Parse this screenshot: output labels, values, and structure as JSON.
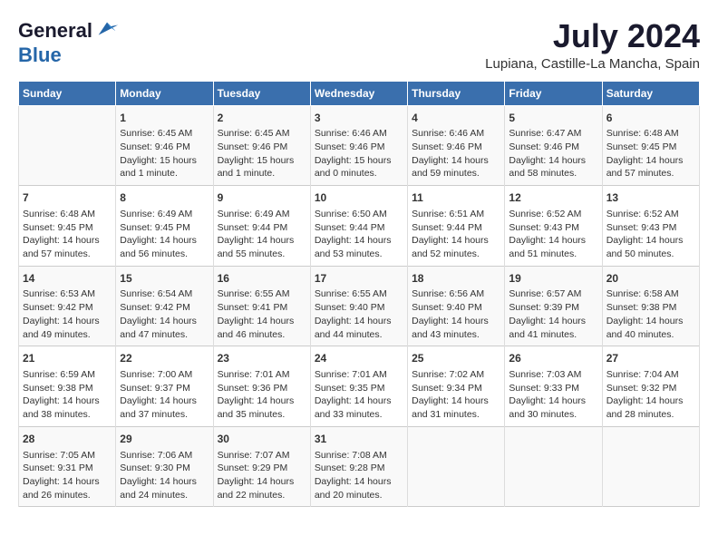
{
  "header": {
    "logo_general": "General",
    "logo_blue": "Blue",
    "month": "July 2024",
    "location": "Lupiana, Castille-La Mancha, Spain"
  },
  "days_of_week": [
    "Sunday",
    "Monday",
    "Tuesday",
    "Wednesday",
    "Thursday",
    "Friday",
    "Saturday"
  ],
  "weeks": [
    [
      {
        "day": "",
        "content": ""
      },
      {
        "day": "1",
        "content": "Sunrise: 6:45 AM\nSunset: 9:46 PM\nDaylight: 15 hours\nand 1 minute."
      },
      {
        "day": "2",
        "content": "Sunrise: 6:45 AM\nSunset: 9:46 PM\nDaylight: 15 hours\nand 1 minute."
      },
      {
        "day": "3",
        "content": "Sunrise: 6:46 AM\nSunset: 9:46 PM\nDaylight: 15 hours\nand 0 minutes."
      },
      {
        "day": "4",
        "content": "Sunrise: 6:46 AM\nSunset: 9:46 PM\nDaylight: 14 hours\nand 59 minutes."
      },
      {
        "day": "5",
        "content": "Sunrise: 6:47 AM\nSunset: 9:46 PM\nDaylight: 14 hours\nand 58 minutes."
      },
      {
        "day": "6",
        "content": "Sunrise: 6:48 AM\nSunset: 9:45 PM\nDaylight: 14 hours\nand 57 minutes."
      }
    ],
    [
      {
        "day": "7",
        "content": "Sunrise: 6:48 AM\nSunset: 9:45 PM\nDaylight: 14 hours\nand 57 minutes."
      },
      {
        "day": "8",
        "content": "Sunrise: 6:49 AM\nSunset: 9:45 PM\nDaylight: 14 hours\nand 56 minutes."
      },
      {
        "day": "9",
        "content": "Sunrise: 6:49 AM\nSunset: 9:44 PM\nDaylight: 14 hours\nand 55 minutes."
      },
      {
        "day": "10",
        "content": "Sunrise: 6:50 AM\nSunset: 9:44 PM\nDaylight: 14 hours\nand 53 minutes."
      },
      {
        "day": "11",
        "content": "Sunrise: 6:51 AM\nSunset: 9:44 PM\nDaylight: 14 hours\nand 52 minutes."
      },
      {
        "day": "12",
        "content": "Sunrise: 6:52 AM\nSunset: 9:43 PM\nDaylight: 14 hours\nand 51 minutes."
      },
      {
        "day": "13",
        "content": "Sunrise: 6:52 AM\nSunset: 9:43 PM\nDaylight: 14 hours\nand 50 minutes."
      }
    ],
    [
      {
        "day": "14",
        "content": "Sunrise: 6:53 AM\nSunset: 9:42 PM\nDaylight: 14 hours\nand 49 minutes."
      },
      {
        "day": "15",
        "content": "Sunrise: 6:54 AM\nSunset: 9:42 PM\nDaylight: 14 hours\nand 47 minutes."
      },
      {
        "day": "16",
        "content": "Sunrise: 6:55 AM\nSunset: 9:41 PM\nDaylight: 14 hours\nand 46 minutes."
      },
      {
        "day": "17",
        "content": "Sunrise: 6:55 AM\nSunset: 9:40 PM\nDaylight: 14 hours\nand 44 minutes."
      },
      {
        "day": "18",
        "content": "Sunrise: 6:56 AM\nSunset: 9:40 PM\nDaylight: 14 hours\nand 43 minutes."
      },
      {
        "day": "19",
        "content": "Sunrise: 6:57 AM\nSunset: 9:39 PM\nDaylight: 14 hours\nand 41 minutes."
      },
      {
        "day": "20",
        "content": "Sunrise: 6:58 AM\nSunset: 9:38 PM\nDaylight: 14 hours\nand 40 minutes."
      }
    ],
    [
      {
        "day": "21",
        "content": "Sunrise: 6:59 AM\nSunset: 9:38 PM\nDaylight: 14 hours\nand 38 minutes."
      },
      {
        "day": "22",
        "content": "Sunrise: 7:00 AM\nSunset: 9:37 PM\nDaylight: 14 hours\nand 37 minutes."
      },
      {
        "day": "23",
        "content": "Sunrise: 7:01 AM\nSunset: 9:36 PM\nDaylight: 14 hours\nand 35 minutes."
      },
      {
        "day": "24",
        "content": "Sunrise: 7:01 AM\nSunset: 9:35 PM\nDaylight: 14 hours\nand 33 minutes."
      },
      {
        "day": "25",
        "content": "Sunrise: 7:02 AM\nSunset: 9:34 PM\nDaylight: 14 hours\nand 31 minutes."
      },
      {
        "day": "26",
        "content": "Sunrise: 7:03 AM\nSunset: 9:33 PM\nDaylight: 14 hours\nand 30 minutes."
      },
      {
        "day": "27",
        "content": "Sunrise: 7:04 AM\nSunset: 9:32 PM\nDaylight: 14 hours\nand 28 minutes."
      }
    ],
    [
      {
        "day": "28",
        "content": "Sunrise: 7:05 AM\nSunset: 9:31 PM\nDaylight: 14 hours\nand 26 minutes."
      },
      {
        "day": "29",
        "content": "Sunrise: 7:06 AM\nSunset: 9:30 PM\nDaylight: 14 hours\nand 24 minutes."
      },
      {
        "day": "30",
        "content": "Sunrise: 7:07 AM\nSunset: 9:29 PM\nDaylight: 14 hours\nand 22 minutes."
      },
      {
        "day": "31",
        "content": "Sunrise: 7:08 AM\nSunset: 9:28 PM\nDaylight: 14 hours\nand 20 minutes."
      },
      {
        "day": "",
        "content": ""
      },
      {
        "day": "",
        "content": ""
      },
      {
        "day": "",
        "content": ""
      }
    ]
  ]
}
